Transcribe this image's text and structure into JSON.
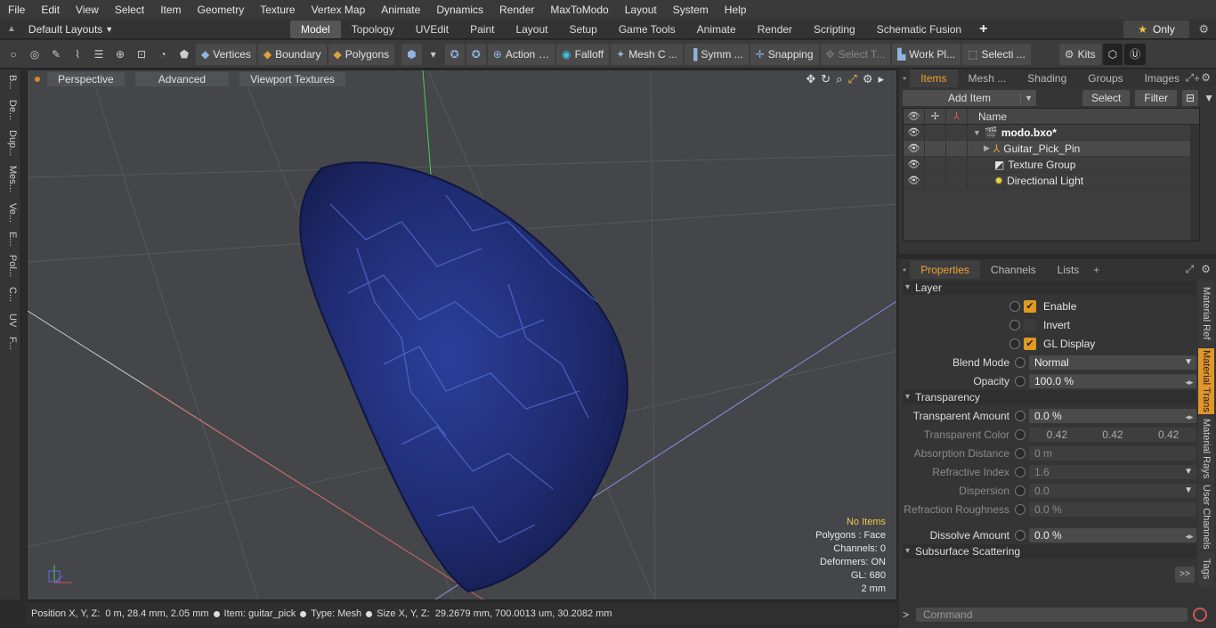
{
  "menu": [
    "File",
    "Edit",
    "View",
    "Select",
    "Item",
    "Geometry",
    "Texture",
    "Vertex Map",
    "Animate",
    "Dynamics",
    "Render",
    "MaxToModo",
    "Layout",
    "System",
    "Help"
  ],
  "layouts": {
    "label": "Default Layouts"
  },
  "tabs": [
    "Model",
    "Topology",
    "UVEdit",
    "Paint",
    "Layout",
    "Setup",
    "Game Tools",
    "Animate",
    "Render",
    "Scripting",
    "Schematic Fusion"
  ],
  "only_label": "Only",
  "toolbar": {
    "vertices": "Vertices",
    "boundary": "Boundary",
    "polygons": "Polygons",
    "action": "Action",
    "falloff": "Falloff",
    "mesh": "Mesh C ...",
    "symm": "Symm ...",
    "snapping": "Snapping",
    "select_t": "Select T...",
    "workplane": "Work Pl...",
    "selecti": "Selecti ...",
    "kits": "Kits"
  },
  "left_tabs": [
    "B...",
    "De...",
    "Dup...",
    "Mes...",
    "Ve...",
    "E...",
    "Pol...",
    "C...",
    "UV",
    "F..."
  ],
  "viewport": {
    "perspective": "Perspective",
    "advanced": "Advanced",
    "textures": "Viewport Textures",
    "info": {
      "items": "No Items",
      "polygons": "Polygons : Face",
      "channels": "Channels: 0",
      "deformers": "Deformers: ON",
      "gl": "GL: 680",
      "scale": "2 mm"
    }
  },
  "status": {
    "pos_label": "Position X, Y, Z:",
    "pos_value": "0 m, 28.4 mm, 2.05 mm",
    "item_label": "Item:",
    "item_value": "guitar_pick",
    "type_label": "Type:",
    "type_value": "Mesh",
    "size_label": "Size X, Y, Z:",
    "size_value": "29.2679 mm, 700.0013 um, 30.2082 mm"
  },
  "items_panel": {
    "tabs": [
      "Items",
      "Mesh ...",
      "Shading",
      "Groups",
      "Images"
    ],
    "add_item": "Add Item",
    "select": "Select",
    "filter": "Filter",
    "name_col": "Name",
    "rows": [
      {
        "label": "modo.bxo*"
      },
      {
        "label": "Guitar_Pick_Pin"
      },
      {
        "label": "Texture Group"
      },
      {
        "label": "Directional Light"
      }
    ]
  },
  "properties": {
    "tabs": [
      "Properties",
      "Channels",
      "Lists"
    ],
    "layer_section": "Layer",
    "enable": "Enable",
    "invert": "Invert",
    "gl_display": "GL Display",
    "blend_mode_label": "Blend Mode",
    "blend_mode_value": "Normal",
    "opacity_label": "Opacity",
    "opacity_value": "100.0 %",
    "transparency_section": "Transparency",
    "transparent_amount_label": "Transparent Amount",
    "transparent_amount_value": "0.0 %",
    "transparent_color_label": "Transparent Color",
    "transparent_color_values": [
      "0.42",
      "0.42",
      "0.42"
    ],
    "absorption_label": "Absorption Distance",
    "absorption_value": "0 m",
    "refractive_label": "Refractive Index",
    "refractive_value": "1.6",
    "dispersion_label": "Dispersion",
    "dispersion_value": "0.0",
    "refraction_rough_label": "Refraction Roughness",
    "refraction_rough_value": "0.0 %",
    "dissolve_label": "Dissolve Amount",
    "dissolve_value": "0.0 %",
    "sss_section": "Subsurface Scattering",
    "side_tabs": [
      "Material Ref",
      "Material Trans",
      "Material Rays",
      "User Channels",
      "Tags"
    ]
  },
  "command_placeholder": "Command",
  "colors": {
    "accent": "#f0a030",
    "pick_blue": "#2a3a8a"
  }
}
